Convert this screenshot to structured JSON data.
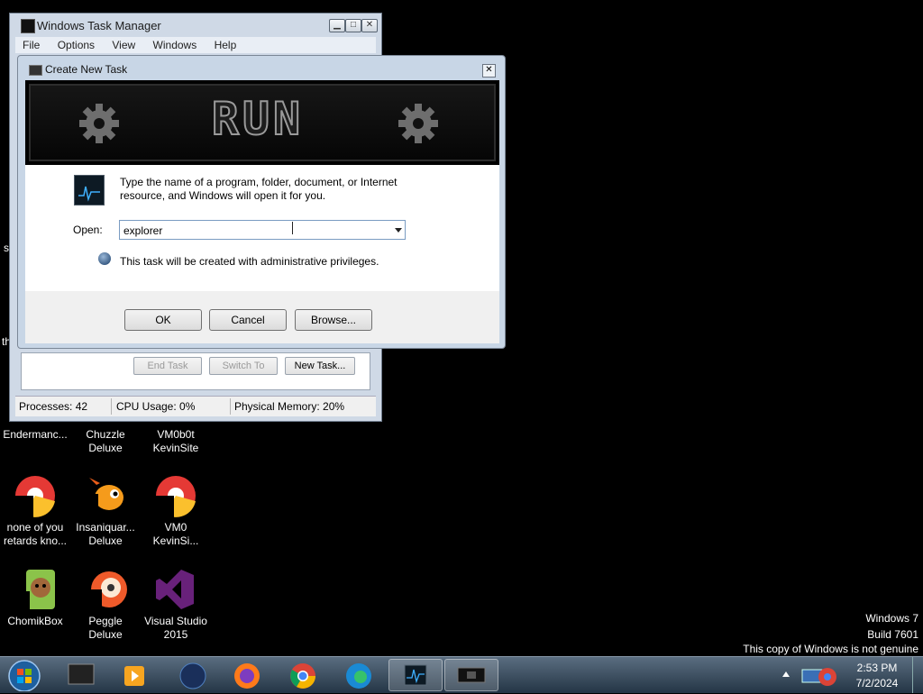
{
  "task_manager": {
    "title": "Windows Task Manager",
    "menus": [
      "File",
      "Options",
      "View",
      "Windows",
      "Help"
    ],
    "buttons": {
      "end_task": "End Task",
      "switch_to": "Switch To",
      "new_task": "New Task..."
    },
    "status": {
      "processes": "Processes: 42",
      "cpu": "CPU Usage: 0%",
      "memory": "Physical Memory: 20%"
    }
  },
  "dialog": {
    "title": "Create New Task",
    "banner_text": "RUN",
    "description_line1": "Type the name of a program, folder, document, or Internet",
    "description_line2": "resource, and Windows will open it for you.",
    "open_label": "Open:",
    "open_value": "explorer",
    "admin_note": "This task will be created with administrative privileges.",
    "buttons": {
      "ok": "OK",
      "cancel": "Cancel",
      "browse": "Browse..."
    }
  },
  "desktop": {
    "edge_letters": {
      "a": "s",
      "b": "th"
    },
    "icons": [
      {
        "line1": "Endermanc...",
        "line2": "",
        "icon": "app-icon"
      },
      {
        "line1": "Chuzzle",
        "line2": "Deluxe",
        "icon": "game-icon"
      },
      {
        "line1": "VM0b0t",
        "line2": "KevinSite",
        "icon": "shortcut-icon"
      },
      {
        "line1": "none of you",
        "line2": "retards kno...",
        "icon": "chrome-like-icon"
      },
      {
        "line1": "Insaniquar...",
        "line2": "Deluxe",
        "icon": "fish-icon"
      },
      {
        "line1": "VM0",
        "line2": "KevinSi...",
        "icon": "chrome-like-icon"
      },
      {
        "line1": "ChomikBox",
        "line2": "",
        "icon": "hamster-icon"
      },
      {
        "line1": "Peggle Deluxe",
        "line2": "",
        "icon": "peggle-icon"
      },
      {
        "line1": "Visual Studio",
        "line2": "2015",
        "icon": "visual-studio-icon"
      }
    ]
  },
  "watermark": {
    "line1": "Windows 7",
    "line2": "Build 7601",
    "line3": "This copy of Windows is not genuine"
  },
  "taskbar": {
    "items": [
      "start-orb",
      "system-icon",
      "media-icon",
      "globe-icon",
      "firefox-icon",
      "chrome-icon",
      "edge-icon",
      "task-manager-icon",
      "run-icon"
    ],
    "time": "2:53 PM",
    "date": "7/2/2024"
  }
}
